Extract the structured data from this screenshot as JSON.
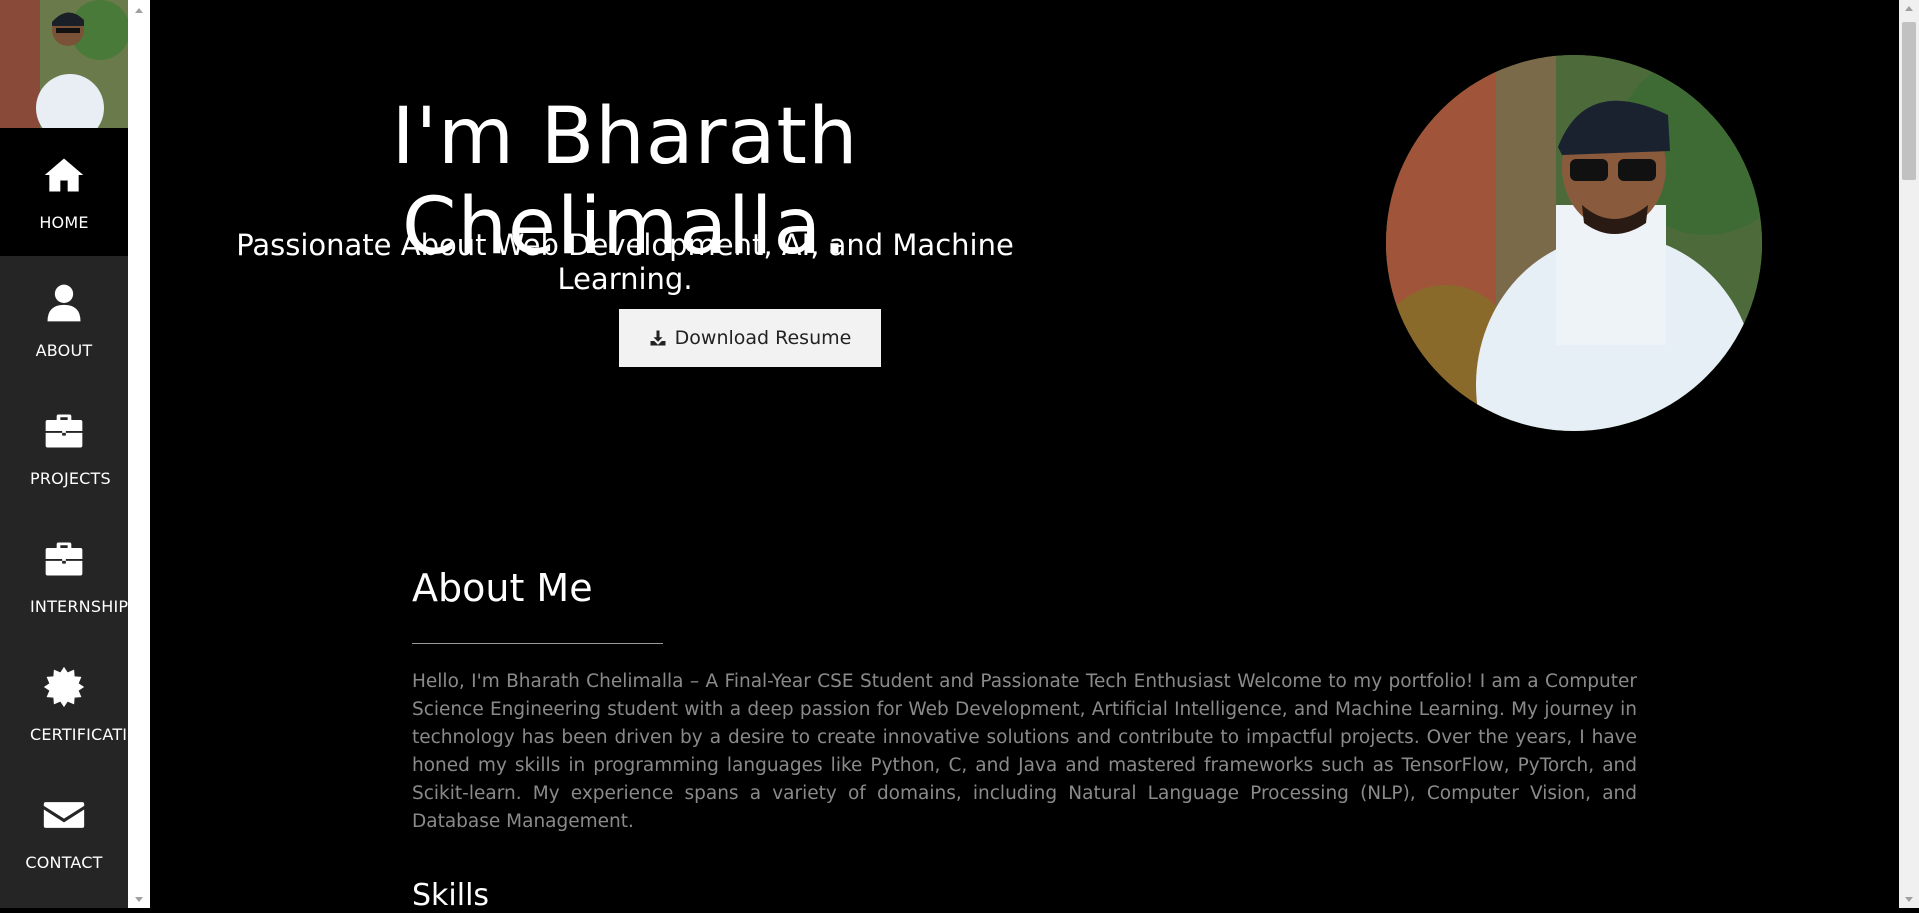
{
  "sidebar": {
    "items": [
      {
        "label": "HOME",
        "icon": "home-icon"
      },
      {
        "label": "ABOUT",
        "icon": "user-icon"
      },
      {
        "label": "PROJECTS",
        "icon": "briefcase-icon"
      },
      {
        "label": "INTERNSHIPS",
        "icon": "briefcase-icon"
      },
      {
        "label": "CERTIFICATIONS",
        "icon": "certificate-icon"
      },
      {
        "label": "CONTACT",
        "icon": "envelope-icon"
      }
    ]
  },
  "hero": {
    "title": "I'm Bharath Chelimalla.",
    "subtitle": "Passionate About Web Development, AI, and Machine Learning.",
    "resume_button": "Download Resume"
  },
  "about": {
    "title": "About Me",
    "body": "Hello, I'm Bharath Chelimalla – A Final-Year CSE Student and Passionate Tech Enthusiast Welcome to my portfolio! I am a Computer Science Engineering student with a deep passion for Web Development, Artificial Intelligence, and Machine Learning. My journey in technology has been driven by a desire to create innovative solutions and contribute to impactful projects. Over the years, I have honed my skills in programming languages like Python, C, and Java and mastered frameworks such as TensorFlow, PyTorch, and Scikit-learn. My experience spans a variety of domains, including Natural Language Processing (NLP), Computer Vision, and Database Management."
  },
  "skills": {
    "title": "Skills"
  },
  "colors": {
    "background": "#000000",
    "sidebar": "#252525",
    "button_bg": "#f2f2f2",
    "body_text": "#8a8a8a"
  }
}
